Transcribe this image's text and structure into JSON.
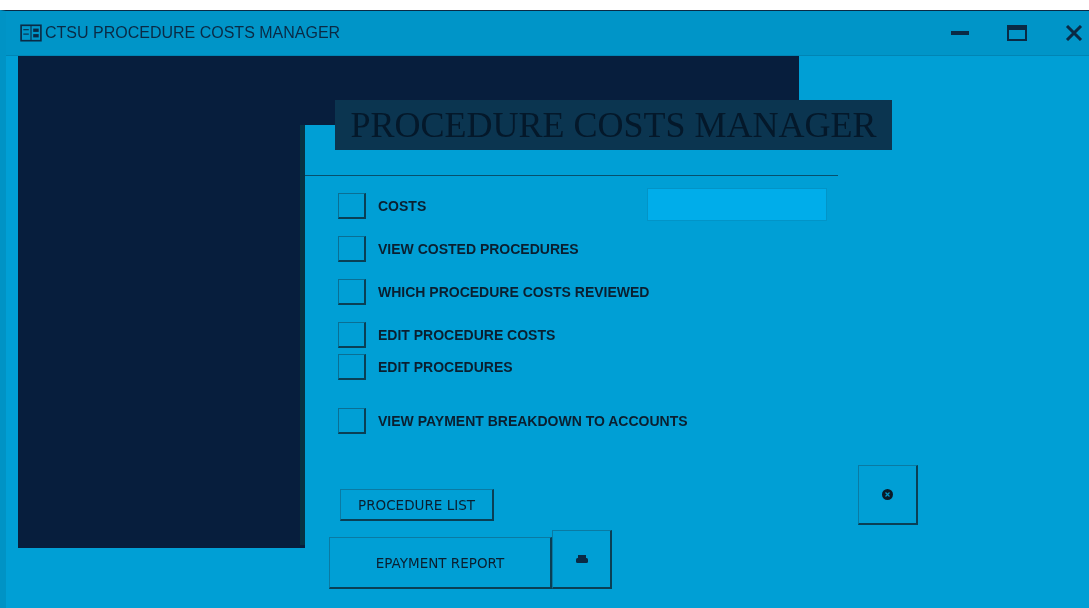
{
  "window": {
    "title": "CTSU PROCEDURE COSTS MANAGER"
  },
  "heading": "PROCEDURE COSTS MANAGER",
  "menu": [
    {
      "label": "COSTS"
    },
    {
      "label": "VIEW COSTED PROCEDURES"
    },
    {
      "label": "WHICH PROCEDURE COSTS REVIEWED"
    },
    {
      "label": "EDIT PROCEDURE COSTS"
    },
    {
      "label": "EDIT PROCEDURES"
    },
    {
      "label": "VIEW PAYMENT BREAKDOWN TO ACCOUNTS"
    }
  ],
  "buttons": {
    "procedure_list": "PROCEDURE LIST",
    "epayment_report": "EPAYMENT REPORT"
  }
}
